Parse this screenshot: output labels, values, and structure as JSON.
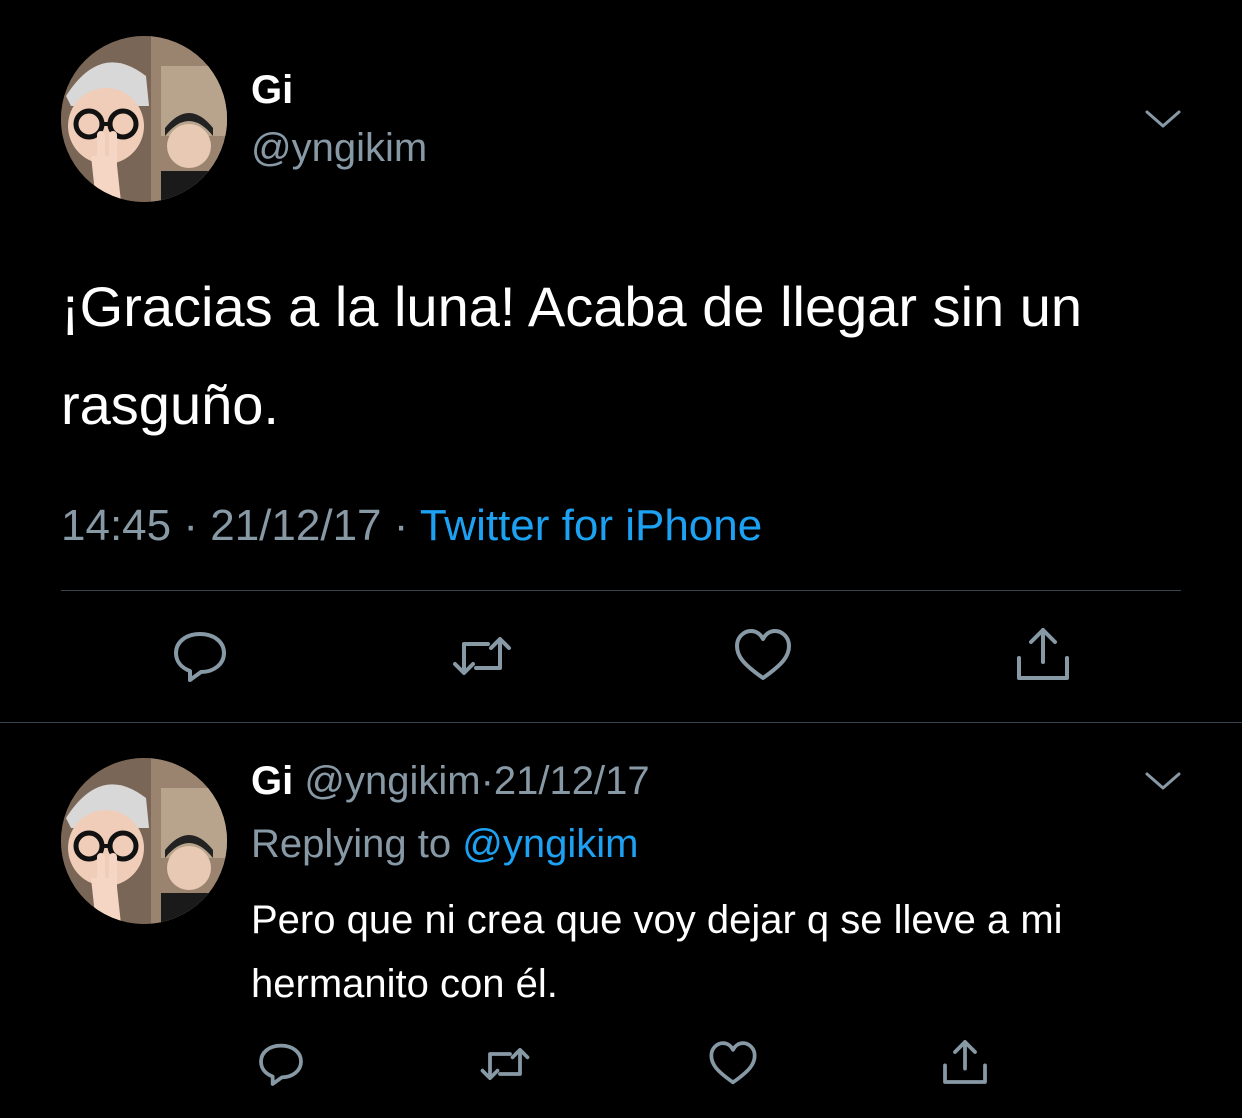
{
  "colors": {
    "background": "#000000",
    "text_primary": "#ffffff",
    "text_secondary": "#8899a6",
    "accent": "#1da1f2",
    "divider": "#38444d"
  },
  "main_tweet": {
    "author_name": "Gi",
    "author_handle": "@yngikim",
    "avatar_icon": "profile-photo",
    "text": "¡Gracias a la luna! Acaba de llegar sin un rasguño.",
    "time": "14:45",
    "separator": "·",
    "date": "21/12/17",
    "source": "Twitter for iPhone",
    "actions": [
      "reply-icon",
      "retweet-icon",
      "like-icon",
      "share-icon"
    ]
  },
  "reply_tweet": {
    "author_name": "Gi",
    "author_handle": "@yngikim",
    "separator": "·",
    "date": "21/12/17",
    "replying_to_label": "Replying to",
    "replying_to_handle": "@yngikim",
    "avatar_icon": "profile-photo",
    "text": "Pero que ni crea que voy dejar q se lleve a mi hermanito con él.",
    "actions": [
      "reply-icon",
      "retweet-icon",
      "like-icon",
      "share-icon"
    ]
  }
}
